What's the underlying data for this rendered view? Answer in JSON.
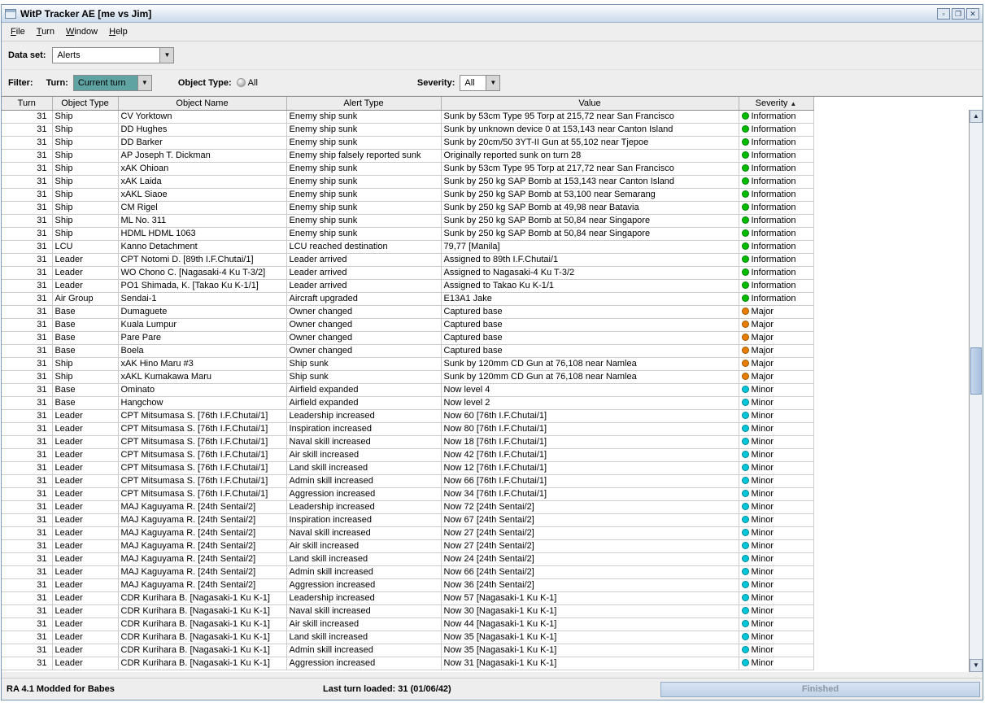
{
  "window": {
    "title": "WitP Tracker AE [me vs Jim]"
  },
  "menu": {
    "items": [
      {
        "label": "File"
      },
      {
        "label": "Turn"
      },
      {
        "label": "Window"
      },
      {
        "label": "Help"
      }
    ]
  },
  "dataset": {
    "label": "Data set:",
    "value": "Alerts"
  },
  "filter": {
    "label": "Filter:",
    "turn_label": "Turn:",
    "turn_value": "Current turn",
    "object_type_label": "Object Type:",
    "object_type_value": "All",
    "severity_label": "Severity:",
    "severity_value": "All"
  },
  "table": {
    "columns": [
      "Turn",
      "Object Type",
      "Object Name",
      "Alert Type",
      "Value",
      "Severity"
    ],
    "col_keys": [
      "turn",
      "object-type",
      "object-name",
      "alert-type",
      "value",
      "severity"
    ],
    "sort_column": "Severity",
    "sort_direction": "ascending",
    "rows": [
      [
        "31",
        "Ship",
        "CV Yorktown",
        "Enemy ship sunk",
        "Sunk by 53cm Type 95 Torp at 215,72 near San Francisco",
        "Information"
      ],
      [
        "31",
        "Ship",
        "DD Hughes",
        "Enemy ship sunk",
        "Sunk by unknown device 0 at 153,143 near Canton Island",
        "Information"
      ],
      [
        "31",
        "Ship",
        "DD Barker",
        "Enemy ship sunk",
        "Sunk by 20cm/50 3YT-II Gun at 55,102 near Tjepoe",
        "Information"
      ],
      [
        "31",
        "Ship",
        "AP Joseph T. Dickman",
        "Enemy ship falsely reported sunk",
        "Originally reported sunk on turn 28",
        "Information"
      ],
      [
        "31",
        "Ship",
        "xAK Ohioan",
        "Enemy ship sunk",
        "Sunk by 53cm Type 95 Torp at 217,72 near San Francisco",
        "Information"
      ],
      [
        "31",
        "Ship",
        "xAK Laida",
        "Enemy ship sunk",
        "Sunk by 250 kg SAP Bomb at 153,143 near Canton Island",
        "Information"
      ],
      [
        "31",
        "Ship",
        "xAKL Siaoe",
        "Enemy ship sunk",
        "Sunk by 250 kg SAP Bomb at 53,100 near Semarang",
        "Information"
      ],
      [
        "31",
        "Ship",
        "CM Rigel",
        "Enemy ship sunk",
        "Sunk by 250 kg SAP Bomb at 49,98 near Batavia",
        "Information"
      ],
      [
        "31",
        "Ship",
        "ML No. 311",
        "Enemy ship sunk",
        "Sunk by 250 kg SAP Bomb at 50,84 near Singapore",
        "Information"
      ],
      [
        "31",
        "Ship",
        "HDML HDML 1063",
        "Enemy ship sunk",
        "Sunk by 250 kg SAP Bomb at 50,84 near Singapore",
        "Information"
      ],
      [
        "31",
        "LCU",
        "Kanno Detachment",
        "LCU reached destination",
        "79,77 [Manila]",
        "Information"
      ],
      [
        "31",
        "Leader",
        "CPT Notomi D. [89th I.F.Chutai/1]",
        "Leader arrived",
        "Assigned to 89th I.F.Chutai/1",
        "Information"
      ],
      [
        "31",
        "Leader",
        "WO Chono C. [Nagasaki-4 Ku T-3/2]",
        "Leader arrived",
        "Assigned to Nagasaki-4 Ku T-3/2",
        "Information"
      ],
      [
        "31",
        "Leader",
        "PO1 Shimada, K. [Takao Ku K-1/1]",
        "Leader arrived",
        "Assigned to Takao Ku K-1/1",
        "Information"
      ],
      [
        "31",
        "Air Group",
        "Sendai-1",
        "Aircraft upgraded",
        "E13A1 Jake",
        "Information"
      ],
      [
        "31",
        "Base",
        "Dumaguete",
        "Owner changed",
        "Captured base",
        "Major"
      ],
      [
        "31",
        "Base",
        "Kuala Lumpur",
        "Owner changed",
        "Captured base",
        "Major"
      ],
      [
        "31",
        "Base",
        "Pare Pare",
        "Owner changed",
        "Captured base",
        "Major"
      ],
      [
        "31",
        "Base",
        "Boela",
        "Owner changed",
        "Captured base",
        "Major"
      ],
      [
        "31",
        "Ship",
        "xAK Hino Maru #3",
        "Ship sunk",
        "Sunk by 120mm CD Gun at 76,108 near Namlea",
        "Major"
      ],
      [
        "31",
        "Ship",
        "xAKL Kumakawa Maru",
        "Ship sunk",
        "Sunk by 120mm CD Gun at 76,108 near Namlea",
        "Major"
      ],
      [
        "31",
        "Base",
        "Ominato",
        "Airfield expanded",
        "Now level 4",
        "Minor"
      ],
      [
        "31",
        "Base",
        "Hangchow",
        "Airfield expanded",
        "Now level 2",
        "Minor"
      ],
      [
        "31",
        "Leader",
        "CPT Mitsumasa S. [76th I.F.Chutai/1]",
        "Leadership increased",
        "Now 60 [76th I.F.Chutai/1]",
        "Minor"
      ],
      [
        "31",
        "Leader",
        "CPT Mitsumasa S. [76th I.F.Chutai/1]",
        "Inspiration increased",
        "Now 80 [76th I.F.Chutai/1]",
        "Minor"
      ],
      [
        "31",
        "Leader",
        "CPT Mitsumasa S. [76th I.F.Chutai/1]",
        "Naval skill increased",
        "Now 18 [76th I.F.Chutai/1]",
        "Minor"
      ],
      [
        "31",
        "Leader",
        "CPT Mitsumasa S. [76th I.F.Chutai/1]",
        "Air skill increased",
        "Now 42 [76th I.F.Chutai/1]",
        "Minor"
      ],
      [
        "31",
        "Leader",
        "CPT Mitsumasa S. [76th I.F.Chutai/1]",
        "Land skill increased",
        "Now 12 [76th I.F.Chutai/1]",
        "Minor"
      ],
      [
        "31",
        "Leader",
        "CPT Mitsumasa S. [76th I.F.Chutai/1]",
        "Admin skill increased",
        "Now 66 [76th I.F.Chutai/1]",
        "Minor"
      ],
      [
        "31",
        "Leader",
        "CPT Mitsumasa S. [76th I.F.Chutai/1]",
        "Aggression increased",
        "Now 34 [76th I.F.Chutai/1]",
        "Minor"
      ],
      [
        "31",
        "Leader",
        "MAJ Kaguyama R. [24th Sentai/2]",
        "Leadership increased",
        "Now 72 [24th Sentai/2]",
        "Minor"
      ],
      [
        "31",
        "Leader",
        "MAJ Kaguyama R. [24th Sentai/2]",
        "Inspiration increased",
        "Now 67 [24th Sentai/2]",
        "Minor"
      ],
      [
        "31",
        "Leader",
        "MAJ Kaguyama R. [24th Sentai/2]",
        "Naval skill increased",
        "Now 27 [24th Sentai/2]",
        "Minor"
      ],
      [
        "31",
        "Leader",
        "MAJ Kaguyama R. [24th Sentai/2]",
        "Air skill increased",
        "Now 27 [24th Sentai/2]",
        "Minor"
      ],
      [
        "31",
        "Leader",
        "MAJ Kaguyama R. [24th Sentai/2]",
        "Land skill increased",
        "Now 24 [24th Sentai/2]",
        "Minor"
      ],
      [
        "31",
        "Leader",
        "MAJ Kaguyama R. [24th Sentai/2]",
        "Admin skill increased",
        "Now 66 [24th Sentai/2]",
        "Minor"
      ],
      [
        "31",
        "Leader",
        "MAJ Kaguyama R. [24th Sentai/2]",
        "Aggression increased",
        "Now 36 [24th Sentai/2]",
        "Minor"
      ],
      [
        "31",
        "Leader",
        "CDR Kurihara B. [Nagasaki-1 Ku K-1]",
        "Leadership increased",
        "Now 57 [Nagasaki-1 Ku K-1]",
        "Minor"
      ],
      [
        "31",
        "Leader",
        "CDR Kurihara B. [Nagasaki-1 Ku K-1]",
        "Naval skill increased",
        "Now 30 [Nagasaki-1 Ku K-1]",
        "Minor"
      ],
      [
        "31",
        "Leader",
        "CDR Kurihara B. [Nagasaki-1 Ku K-1]",
        "Air skill increased",
        "Now 44 [Nagasaki-1 Ku K-1]",
        "Minor"
      ],
      [
        "31",
        "Leader",
        "CDR Kurihara B. [Nagasaki-1 Ku K-1]",
        "Land skill increased",
        "Now 35 [Nagasaki-1 Ku K-1]",
        "Minor"
      ],
      [
        "31",
        "Leader",
        "CDR Kurihara B. [Nagasaki-1 Ku K-1]",
        "Admin skill increased",
        "Now 35 [Nagasaki-1 Ku K-1]",
        "Minor"
      ],
      [
        "31",
        "Leader",
        "CDR Kurihara B. [Nagasaki-1 Ku K-1]",
        "Aggression increased",
        "Now 31 [Nagasaki-1 Ku K-1]",
        "Minor"
      ]
    ]
  },
  "severity_colors": {
    "Information": "#00bb00",
    "Major": "#e87e00",
    "Minor": "#00c8da"
  },
  "statusbar": {
    "left": "RA 4.1 Modded for Babes",
    "center": "Last turn loaded: 31 (01/06/42)",
    "progress": "Finished"
  }
}
